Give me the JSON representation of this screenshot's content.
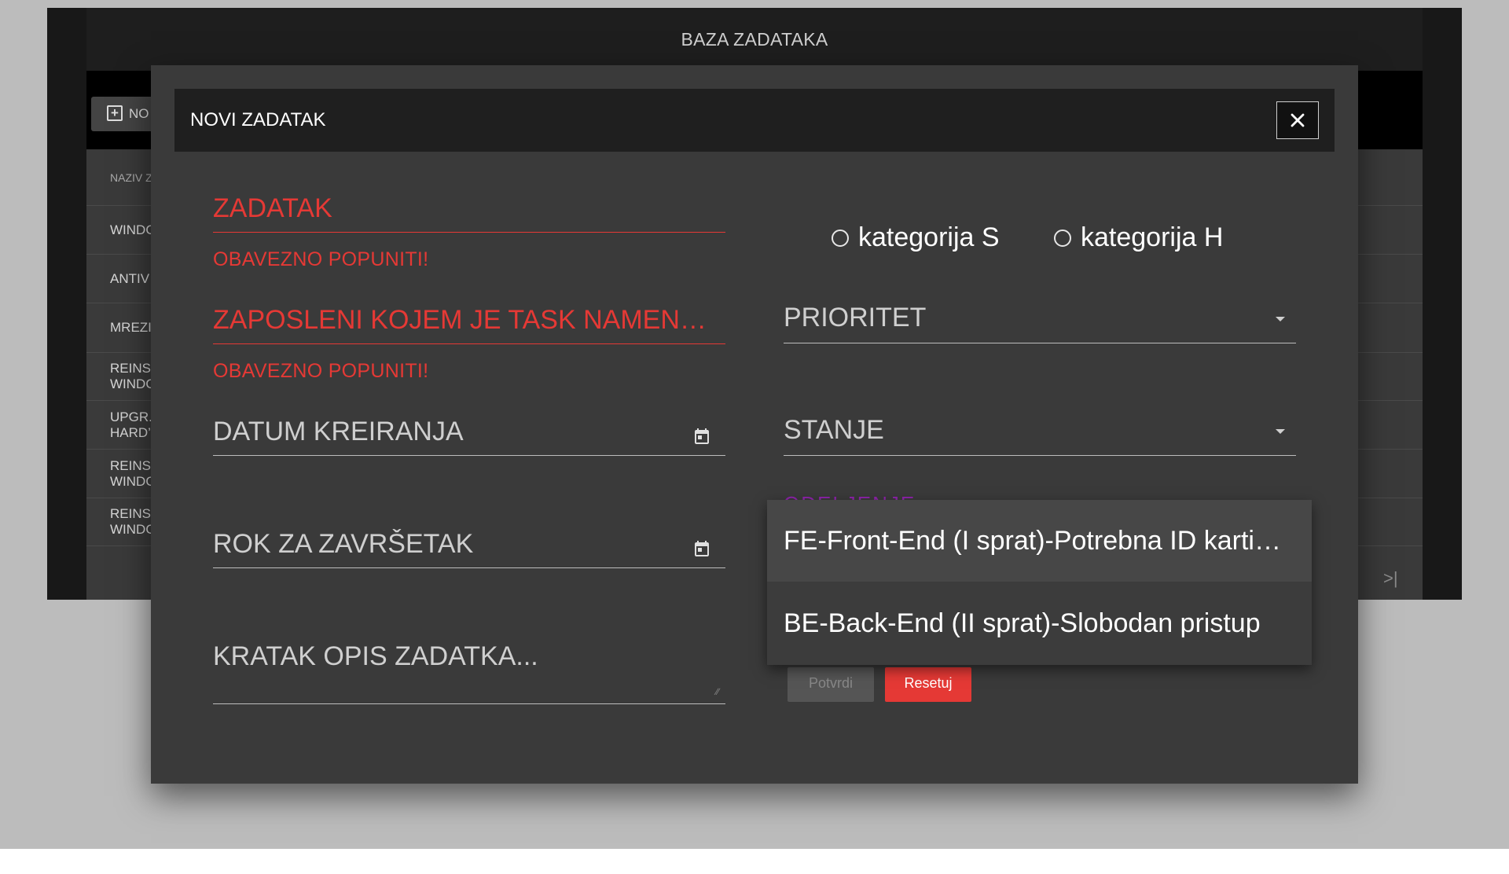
{
  "app": {
    "title": "BAZA ZADATAKA",
    "new_button_label": "NO",
    "table": {
      "header": "NAZIV Z",
      "rows": [
        "WINDO",
        "ANTIV",
        "MREZI",
        "REINS\nWINDO",
        "UPGR.\nHARD’",
        "REINS\nWINDO",
        "REINS\nWINDO"
      ]
    }
  },
  "modal": {
    "title": "NOVI ZADATAK",
    "fields": {
      "zadatak": {
        "label": "ZADATAK",
        "error": "OBAVEZNO POPUNITI!"
      },
      "zaposleni": {
        "label": "ZAPOSLENI KOJEM JE TASK NAMEN…",
        "error": "OBAVEZNO POPUNITI!"
      },
      "datum_kreiranja": {
        "label": "DATUM KREIRANJA"
      },
      "rok": {
        "label": "ROK ZA ZAVRŠETAK"
      },
      "opis": {
        "label": "KRATAK OPIS ZADATKA..."
      },
      "prioritet": {
        "label": "PRIORITET"
      },
      "stanje": {
        "label": "STANJE"
      },
      "odeljenje": {
        "label": "ODELJENJE"
      }
    },
    "radios": {
      "s": "kategorija S",
      "h": "kategorija H"
    },
    "buttons": {
      "confirm": "Potvrdi",
      "reset": "Resetuj"
    },
    "dropdown": {
      "options": [
        "FE-Front-End (I sprat)-Potrebna ID karti…",
        "BE-Back-End (II sprat)-Slobodan pristup"
      ]
    }
  },
  "colors": {
    "error": "#e53935",
    "modal_bg": "#3a3a3a",
    "header_bg": "#1f1f1f"
  }
}
